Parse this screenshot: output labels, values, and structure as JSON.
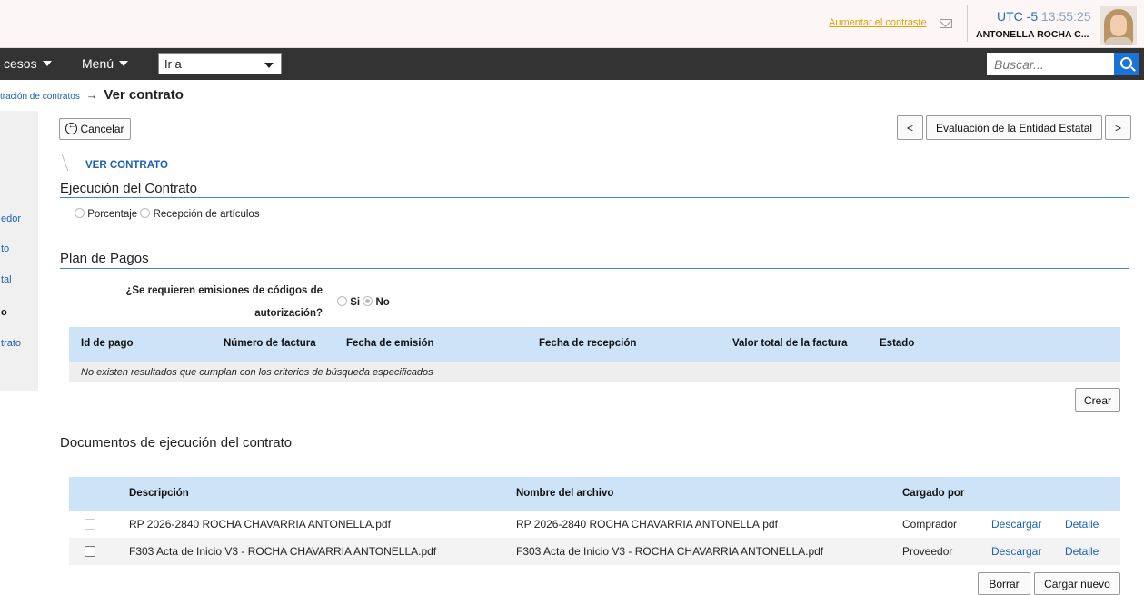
{
  "header": {
    "contrast_link": "Aumentar el contraste",
    "timezone": "UTC -5",
    "time": "13:55:25",
    "username": "ANTONELLA ROCHA C..."
  },
  "navbar": {
    "processes_label": "cesos",
    "menu_label": "Menú",
    "goto_value": "Ir a",
    "search_placeholder": "Buscar..."
  },
  "breadcrumb": {
    "parent": "tración de contratos",
    "separator": "→",
    "current": "Ver contrato"
  },
  "sidebar": {
    "items": [
      {
        "label": "edor",
        "active": false
      },
      {
        "label": "to",
        "active": false
      },
      {
        "label": "tal",
        "active": false
      },
      {
        "label": "o",
        "active": true
      },
      {
        "label": "trato",
        "active": false
      }
    ]
  },
  "toolbar": {
    "cancel_label": "Cancelar",
    "prev_label": "<",
    "next_label": ">",
    "stage_nav_label": "Evaluación de la Entidad Estatal"
  },
  "stage_title": "VER CONTRATO",
  "execution": {
    "title": "Ejecución del Contrato",
    "options": [
      "Porcentaje",
      "Recepción de artículos"
    ]
  },
  "payments": {
    "title": "Plan de Pagos",
    "question_line1": "¿Se requieren emisiones de códigos de",
    "question_line2": "autorización?",
    "options": [
      {
        "label": "Si",
        "checked": false
      },
      {
        "label": "No",
        "checked": true
      }
    ],
    "columns": [
      "Id de pago",
      "Número de factura",
      "Fecha de emisión",
      "Fecha de recepción",
      "Valor total de la factura",
      "Estado"
    ],
    "empty_message": "No existen resultados que cumplan con los criterios de búsqueda especificados",
    "create_label": "Crear"
  },
  "documents": {
    "title": "Documentos de ejecución del contrato",
    "columns": [
      "Descripción",
      "Nombre del archivo",
      "Cargado por"
    ],
    "rows": [
      {
        "description": "RP 2026-2840 ROCHA CHAVARRIA ANTONELLA.pdf",
        "filename": "RP 2026-2840 ROCHA CHAVARRIA ANTONELLA.pdf",
        "uploaded_by": "Comprador",
        "download": "Descargar",
        "detail": "Detalle",
        "checkbox_disabled": true
      },
      {
        "description": "F303 Acta de Inicio V3 - ROCHA CHAVARRIA ANTONELLA.pdf",
        "filename": "F303 Acta de Inicio V3 - ROCHA CHAVARRIA ANTONELLA.pdf",
        "uploaded_by": "Proveedor",
        "download": "Descargar",
        "detail": "Detalle",
        "checkbox_disabled": false
      }
    ],
    "delete_label": "Borrar",
    "upload_label": "Cargar nuevo"
  },
  "colors": {
    "accent": "#1a62b3",
    "navbar": "#333333",
    "table_header": "#cde3f7",
    "contrast_link": "#e8a100"
  }
}
